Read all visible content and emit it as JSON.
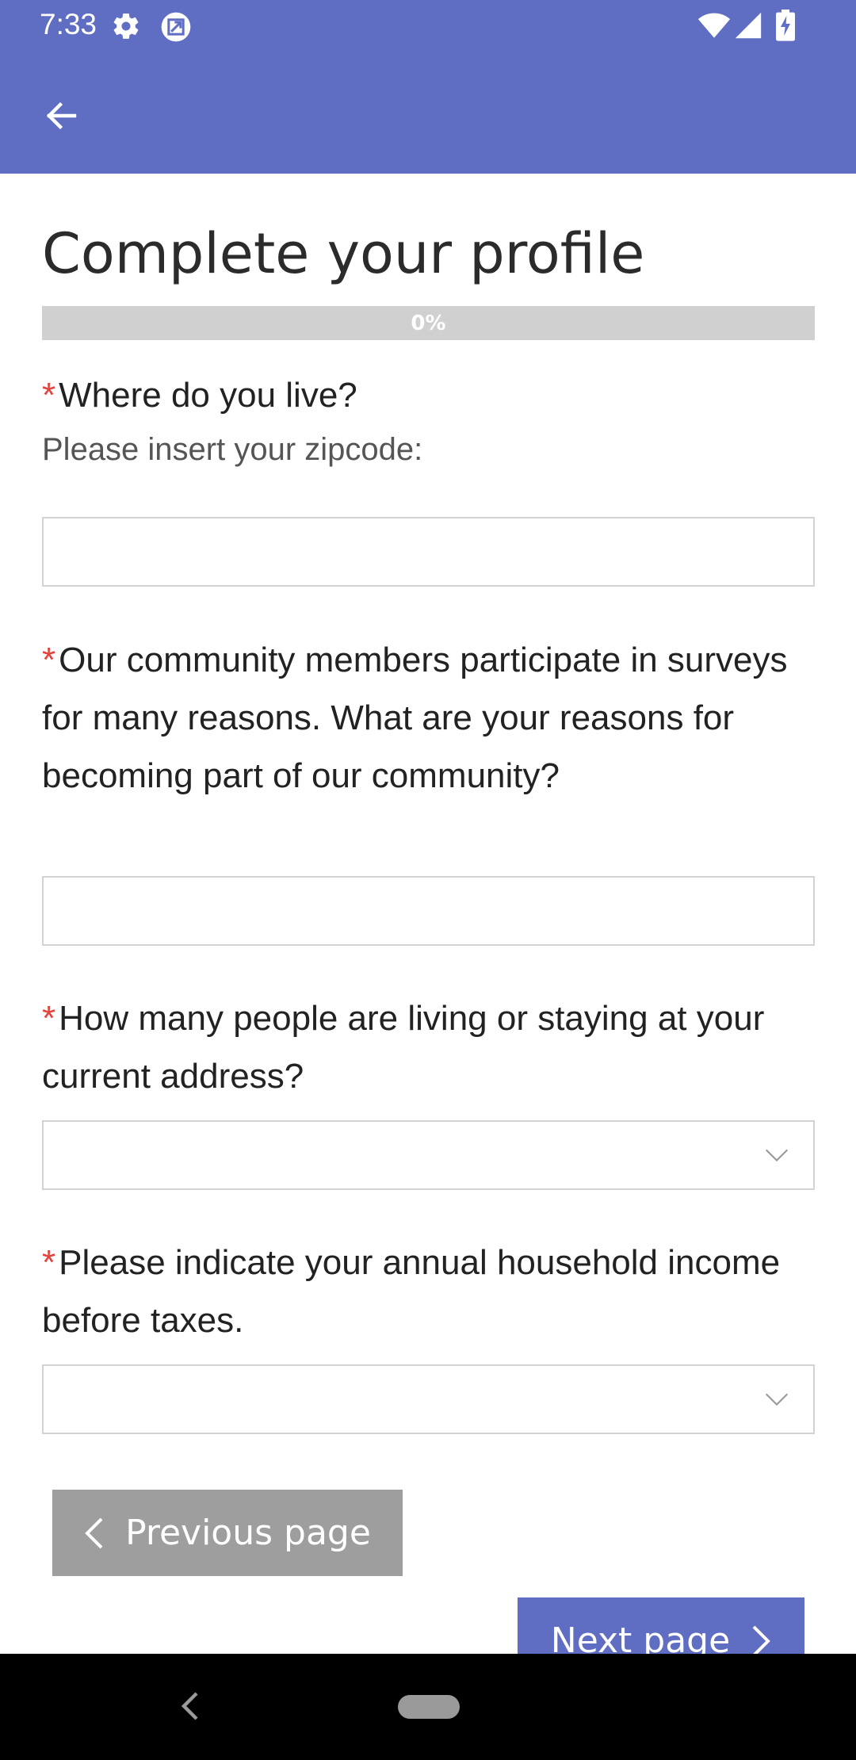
{
  "status_bar": {
    "time": "7:33",
    "left_icons": [
      "gear-icon",
      "app-notification-icon"
    ],
    "right_icons": [
      "wifi-icon",
      "signal-icon",
      "battery-charging-icon"
    ]
  },
  "app_bar": {
    "back_icon": "arrow-left-icon",
    "background_color": "#5f6dc2"
  },
  "page": {
    "title": "Complete your profile",
    "progress": {
      "percent_value": 0,
      "label": "0%"
    }
  },
  "questions": [
    {
      "required_marker": "*",
      "text": "Where do you live?",
      "hint": "Please insert your zipcode:",
      "input_type": "text",
      "value": ""
    },
    {
      "required_marker": "*",
      "text": "Our community members participate in surveys for many reasons. What are your reasons for becoming part of our community?",
      "input_type": "text",
      "value": ""
    },
    {
      "required_marker": "*",
      "text": "How many people are living or staying at your current address?",
      "input_type": "select",
      "value": ""
    },
    {
      "required_marker": "*",
      "text": "Please indicate your annual household income before taxes.",
      "input_type": "select",
      "value": ""
    }
  ],
  "buttons": {
    "previous_label": "Previous page",
    "next_label": "Next page"
  },
  "colors": {
    "accent": "#5f6dc2",
    "required": "#e0443c",
    "disabled_button": "#9e9e9e",
    "progress_track": "#d0d0d0"
  },
  "nav_bar": {
    "icons": [
      "nav-back-icon",
      "nav-home-pill"
    ]
  }
}
